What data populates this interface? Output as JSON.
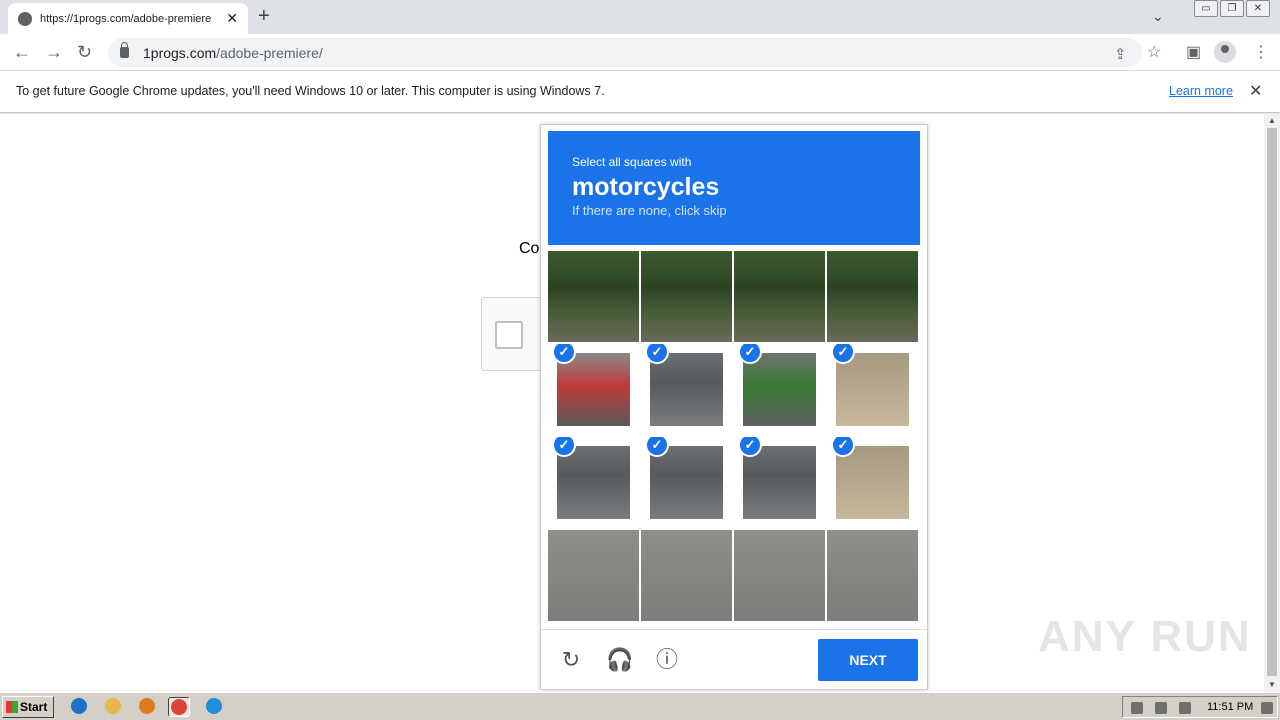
{
  "browser": {
    "tab": {
      "title": "https://1progs.com/adobe-premiere",
      "close": "✕"
    },
    "new_tab": "+",
    "tab_search": "⌄",
    "window_buttons": [
      "▭",
      "❐",
      "✕"
    ],
    "nav": {
      "back": "←",
      "forward": "→",
      "reload": "↻"
    },
    "url": {
      "domain": "1progs.com",
      "path": "/adobe-premiere/"
    },
    "omnibox_icons": {
      "share": "⇪",
      "bookmark": "☆"
    },
    "toolbar_icons": {
      "sidepanel": "▣",
      "menu": "⋮"
    }
  },
  "infobar": {
    "message": "To get future Google Chrome updates, you'll need Windows 10 or later. This computer is using Windows 7.",
    "link": "Learn more",
    "close": "✕"
  },
  "page": {
    "covered_text": "Co"
  },
  "captcha": {
    "prompt_line1": "Select all squares with",
    "prompt_target": "motorcycles",
    "prompt_line3": "If there are none, click skip",
    "check_glyph": "✓",
    "tiles": [
      {
        "scene": "trees",
        "selected": false
      },
      {
        "scene": "trees",
        "selected": false
      },
      {
        "scene": "trees",
        "selected": false
      },
      {
        "scene": "trees",
        "selected": false
      },
      {
        "scene": "moto-red",
        "selected": true
      },
      {
        "scene": "moto",
        "selected": true
      },
      {
        "scene": "moto-green",
        "selected": true
      },
      {
        "scene": "dirt",
        "selected": true
      },
      {
        "scene": "moto",
        "selected": true
      },
      {
        "scene": "moto",
        "selected": true
      },
      {
        "scene": "moto",
        "selected": true
      },
      {
        "scene": "dirt",
        "selected": true
      },
      {
        "scene": "road",
        "selected": false
      },
      {
        "scene": "road",
        "selected": false
      },
      {
        "scene": "road",
        "selected": false
      },
      {
        "scene": "road",
        "selected": false
      }
    ],
    "footer": {
      "reload_icon": "↻",
      "audio_icon": "🎧",
      "info_icon": "ⓘ",
      "next_label": "NEXT"
    }
  },
  "watermark": "ANY RUN",
  "taskbar": {
    "start_label": "Start",
    "clock": "11:51 PM",
    "apps": [
      {
        "name": "ie",
        "color": "#1e73c8",
        "active": false
      },
      {
        "name": "explorer",
        "color": "#e8b84a",
        "active": false
      },
      {
        "name": "media",
        "color": "#e07a20",
        "active": false
      },
      {
        "name": "chrome",
        "color": "#db4437",
        "active": true
      },
      {
        "name": "edge",
        "color": "#1f8fd8",
        "active": false
      }
    ]
  }
}
